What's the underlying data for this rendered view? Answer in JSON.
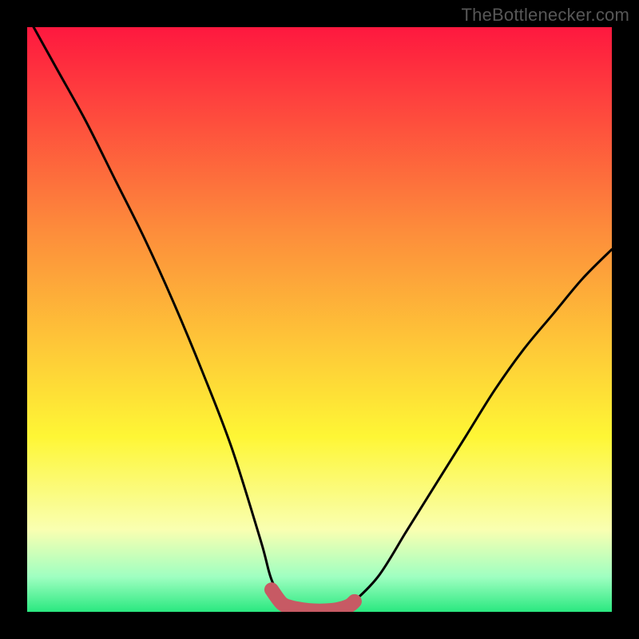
{
  "watermark": "TheBottlenecker.com",
  "colors": {
    "top": "#fe183f",
    "mid_upper": "#fd8d3b",
    "mid": "#fef635",
    "mid_lower": "#f9ffb1",
    "green_light": "#9fffc1",
    "green": "#2ae880",
    "curve": "#000000",
    "marker": "#c75a64"
  },
  "chart_data": {
    "type": "line",
    "title": "",
    "xlabel": "",
    "ylabel": "",
    "xlim": [
      0,
      1
    ],
    "ylim": [
      0,
      1
    ],
    "series": [
      {
        "name": "bottleneck-curve",
        "x": [
          0.0,
          0.05,
          0.1,
          0.15,
          0.2,
          0.25,
          0.3,
          0.35,
          0.4,
          0.42,
          0.45,
          0.48,
          0.5,
          0.53,
          0.55,
          0.6,
          0.65,
          0.7,
          0.75,
          0.8,
          0.85,
          0.9,
          0.95,
          1.0
        ],
        "y": [
          1.02,
          0.93,
          0.84,
          0.74,
          0.64,
          0.53,
          0.41,
          0.28,
          0.12,
          0.05,
          0.01,
          0.0,
          0.0,
          0.0,
          0.01,
          0.06,
          0.14,
          0.22,
          0.3,
          0.38,
          0.45,
          0.51,
          0.57,
          0.62
        ]
      },
      {
        "name": "bottom-markers",
        "x": [
          0.418,
          0.435,
          0.45,
          0.47,
          0.49,
          0.51,
          0.53,
          0.55,
          0.56
        ],
        "y": [
          0.038,
          0.015,
          0.008,
          0.004,
          0.002,
          0.002,
          0.004,
          0.01,
          0.018
        ]
      }
    ],
    "background_gradient_stops": [
      {
        "pos": 0.0,
        "color": "#fe183f"
      },
      {
        "pos": 0.35,
        "color": "#fd8d3b"
      },
      {
        "pos": 0.7,
        "color": "#fef635"
      },
      {
        "pos": 0.86,
        "color": "#f9ffb1"
      },
      {
        "pos": 0.94,
        "color": "#9fffc1"
      },
      {
        "pos": 1.0,
        "color": "#2ae880"
      }
    ]
  }
}
